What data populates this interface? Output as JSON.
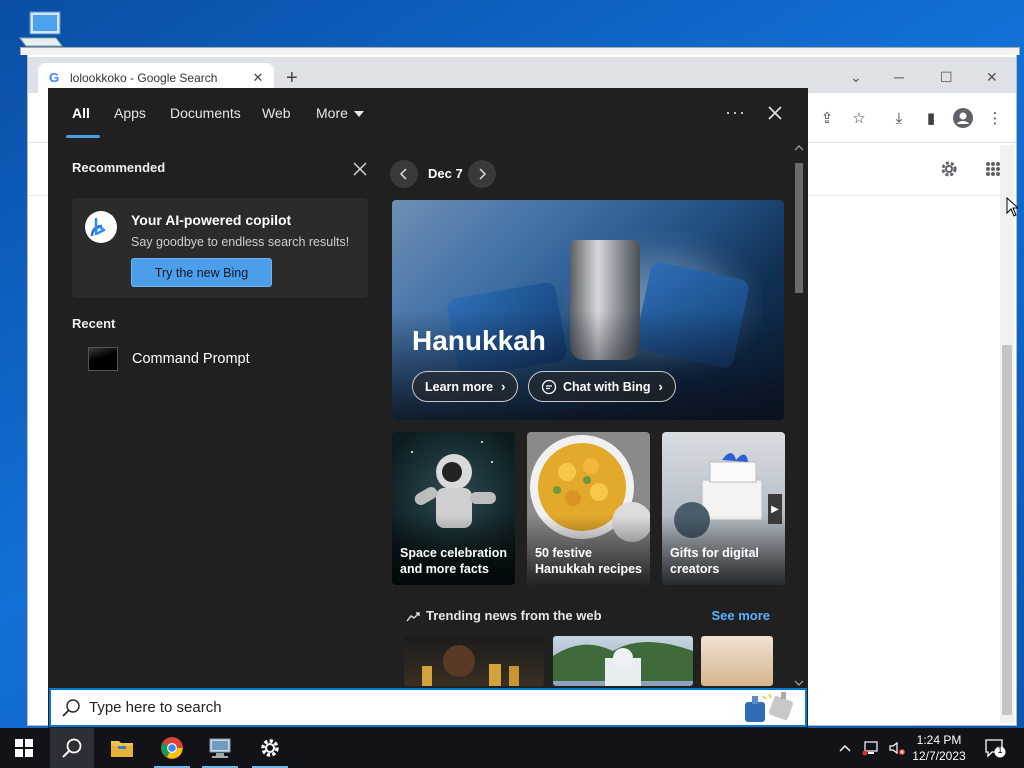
{
  "chrome": {
    "tab_title": "lolookkoko - Google Search",
    "tab_close": "✕",
    "new_tab": "+"
  },
  "panel": {
    "tabs": [
      "All",
      "Apps",
      "Documents",
      "Web",
      "More"
    ],
    "dots": "···",
    "recommended_title": "Recommended",
    "card_title": "Your AI-powered copilot",
    "card_subtitle": "Say goodbye to endless search results!",
    "card_button": "Try the new Bing",
    "recent_title": "Recent",
    "recent_items": [
      "Command Prompt"
    ],
    "date": "Dec 7",
    "hero_title": "Hanukkah",
    "hero_learn_more": "Learn more",
    "hero_chat": "Chat with Bing",
    "tiles": [
      {
        "line1": "Space celebration",
        "line2": "and more facts"
      },
      {
        "line1": "50 festive",
        "line2": "Hanukkah recipes"
      },
      {
        "line1": "Gifts for digital",
        "line2": "creators"
      }
    ],
    "trending_title": "Trending news from the web",
    "see_more": "See more"
  },
  "search": {
    "placeholder": "Type here to search"
  },
  "taskbar": {
    "time": "1:24 PM",
    "date": "12/7/2023",
    "notification_count": "1"
  },
  "colors": {
    "accent": "#0078d4",
    "link": "#5ab0ff",
    "bing_button": "#4d9ee8",
    "panel_bg": "#202020"
  },
  "icons": [
    "windows-logo-icon",
    "search-icon",
    "file-explorer-icon",
    "chrome-icon",
    "network-icon",
    "settings-icon",
    "chevron-up-icon",
    "volume-muted-icon",
    "notification-icon",
    "bing-icon",
    "close-icon",
    "trend-icon",
    "chat-icon"
  ]
}
